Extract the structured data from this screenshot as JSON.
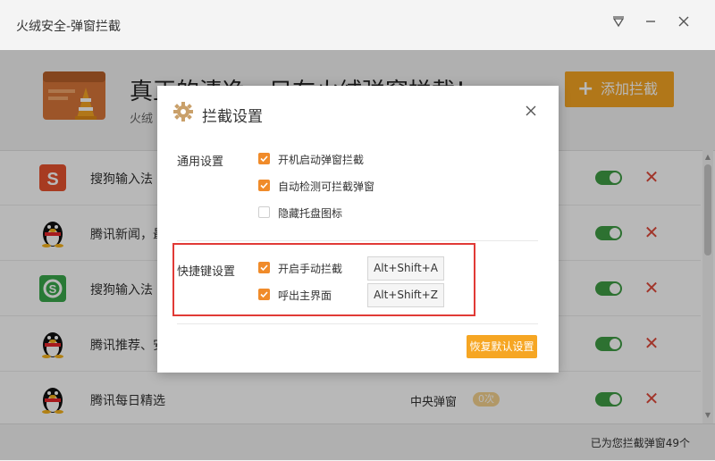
{
  "window": {
    "title": "火绒安全-弹窗拦截",
    "menu_icon": "menu-triangle-icon",
    "minimize_icon": "minimize-icon",
    "close_icon": "close-icon"
  },
  "header": {
    "slogan": "真正的清净，只在火绒弹窗拦截！",
    "subslogan": "火绒",
    "add_button": {
      "icon": "plus",
      "label": "添加拦截"
    }
  },
  "list": {
    "rows": [
      {
        "name": "搜狗输入法",
        "icon": "sogou-icon",
        "type": "",
        "count": "",
        "enabled": true
      },
      {
        "name": "腾讯新闻，最",
        "icon": "qq-penguin-icon",
        "type": "",
        "count": "",
        "enabled": true
      },
      {
        "name": "搜狗输入法",
        "icon": "sogou-green-icon",
        "type": "",
        "count": "",
        "enabled": true
      },
      {
        "name": "腾讯推荐、安",
        "icon": "qq-penguin-icon",
        "type": "",
        "count": "",
        "enabled": true
      },
      {
        "name": "腾讯每日精选",
        "icon": "qq-penguin-icon",
        "type": "中央弹窗",
        "count": "0次",
        "enabled": true
      }
    ]
  },
  "footer": {
    "text": "已为您拦截弹窗49个"
  },
  "dialog": {
    "title": "拦截设置",
    "close_icon": "close-icon",
    "general": {
      "label": "通用设置",
      "options": [
        {
          "label": "开机启动弹窗拦截",
          "checked": true
        },
        {
          "label": "自动检测可拦截弹窗",
          "checked": true
        },
        {
          "label": "隐藏托盘图标",
          "checked": false
        }
      ]
    },
    "hotkeys": {
      "label": "快捷键设置",
      "options": [
        {
          "label": "开启手动拦截",
          "checked": true,
          "hotkey": "Alt+Shift+A"
        },
        {
          "label": "呼出主界面",
          "checked": true,
          "hotkey": "Alt+Shift+Z"
        }
      ]
    },
    "restore_button": "恢复默认设置"
  },
  "colors": {
    "accent": "#f6a623",
    "checkbox": "#f08b2a",
    "toggle_on": "#3f9d44",
    "delete": "#e04a3b",
    "highlight": "#e13a36"
  }
}
